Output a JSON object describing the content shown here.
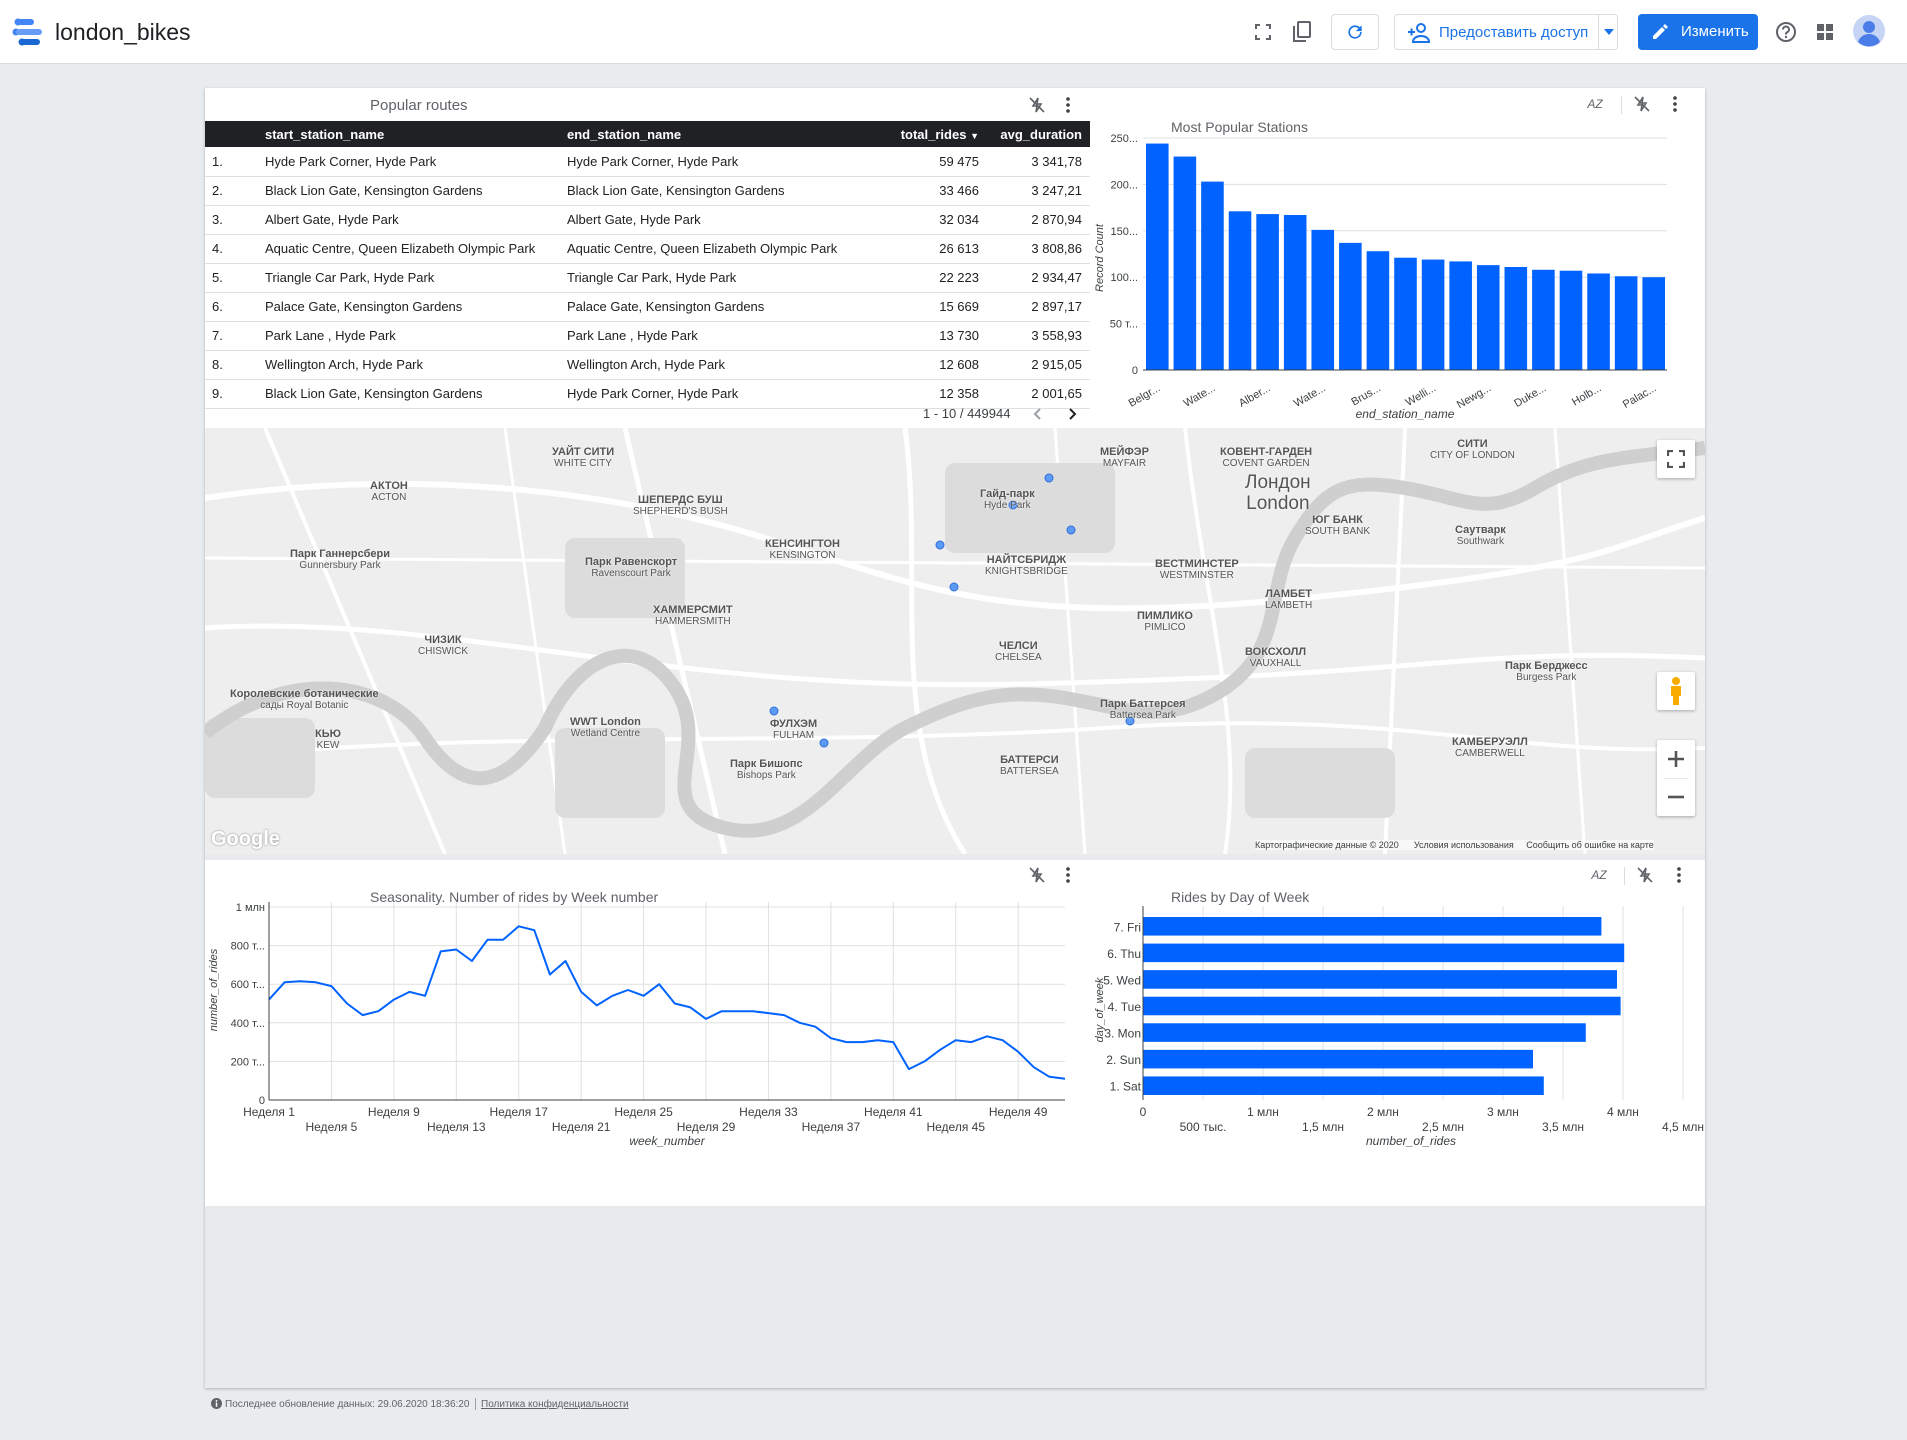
{
  "header": {
    "title": "london_bikes",
    "share_label": "Предоставить доступ",
    "edit_label": "Изменить"
  },
  "routes_table": {
    "title": "Popular routes",
    "columns": [
      "start_station_name",
      "end_station_name",
      "total_rides",
      "avg_duration"
    ],
    "rows": [
      [
        "1.",
        "Hyde Park Corner, Hyde Park",
        "Hyde Park Corner, Hyde Park",
        "59 475",
        "3 341,78"
      ],
      [
        "2.",
        "Black Lion Gate, Kensington Gardens",
        "Black Lion Gate, Kensington Gardens",
        "33 466",
        "3 247,21"
      ],
      [
        "3.",
        "Albert Gate, Hyde Park",
        "Albert Gate, Hyde Park",
        "32 034",
        "2 870,94"
      ],
      [
        "4.",
        "Aquatic Centre, Queen Elizabeth Olympic Park",
        "Aquatic Centre, Queen Elizabeth Olympic Park",
        "26 613",
        "3 808,86"
      ],
      [
        "5.",
        "Triangle Car Park, Hyde Park",
        "Triangle Car Park, Hyde Park",
        "22 223",
        "2 934,47"
      ],
      [
        "6.",
        "Palace Gate, Kensington Gardens",
        "Palace Gate, Kensington Gardens",
        "15 669",
        "2 897,17"
      ],
      [
        "7.",
        "Park Lane , Hyde Park",
        "Park Lane , Hyde Park",
        "13 730",
        "3 558,93"
      ],
      [
        "8.",
        "Wellington Arch, Hyde Park",
        "Wellington Arch, Hyde Park",
        "12 608",
        "2 915,05"
      ],
      [
        "9.",
        "Black Lion Gate, Kensington Gardens",
        "Hyde Park Corner, Hyde Park",
        "12 358",
        "2 001,65"
      ]
    ],
    "pagination": "1 - 10 / 449944",
    "sort_arrow": "▼"
  },
  "map": {
    "labels": [
      [
        "АКТОН",
        "ACTON"
      ],
      [
        "УАЙТ СИТИ",
        "WHITE CITY"
      ],
      [
        "ШЕПЕРДС БУШ",
        "SHEPHERD'S BUSH"
      ],
      [
        "КЕНСИНГТОН",
        "KENSINGTON"
      ],
      [
        "НАЙТСБРИДЖ",
        "KNIGHTSBRIDGE"
      ],
      [
        "Гайд-парк",
        "Hyde Park"
      ],
      [
        "МЕЙФЭР",
        "MAYFAIR"
      ],
      [
        "КОВЕНТ-ГАРДЕН",
        "COVENT GARDEN"
      ],
      [
        "СИТИ",
        "CITY OF LONDON"
      ],
      [
        "Лондон",
        "London"
      ],
      [
        "ЮГ БАНК",
        "SOUTH BANK"
      ],
      [
        "Саутварк",
        "Southwark"
      ],
      [
        "ВЕСТМИНСТЕР",
        "WESTMINSTER"
      ],
      [
        "ЛАМБЕТ",
        "LAMBETH"
      ],
      [
        "ПИМЛИКО",
        "PIMLICO"
      ],
      [
        "ВОКСХОЛЛ",
        "VAUXHALL"
      ],
      [
        "ЧЕЛСИ",
        "CHELSEA"
      ],
      [
        "ХАММЕРСМИТ",
        "HAMMERSMITH"
      ],
      [
        "ЧИЗИК",
        "CHISWICK"
      ],
      [
        "ФУЛХЭМ",
        "FULHAM"
      ],
      [
        "КЬЮ",
        "KEW"
      ],
      [
        "БАТТЕРСИ",
        "BATTERSEA"
      ],
      [
        "КАМБЕРУЭЛЛ",
        "CAMBERWELL"
      ],
      [
        "Парк Равенскорт",
        "Ravenscourt Park"
      ],
      [
        "Парк Ганнерсбери",
        "Gunnersbury Park"
      ],
      [
        "WWT London",
        "Wetland Centre"
      ],
      [
        "Парк Баттерсея",
        "Battersea Park"
      ],
      [
        "Парк Бишопс",
        "Bishops Park"
      ],
      [
        "Парк Берджесс",
        "Burgess Park"
      ],
      [
        "Королевские ботанические",
        "сады Royal Botanic"
      ]
    ],
    "google": "Google",
    "attribution": "Картографические данные © 2020",
    "terms": "Условия использования",
    "report": "Сообщить об ошибке на карте"
  },
  "stations_chart": {
    "title": "Most Popular Stations",
    "icon_sort": "AZ"
  },
  "weeks_chart": {
    "title": "Seasonality. Number of rides by Week number"
  },
  "days_chart": {
    "title": "Rides by Day of Week",
    "icon_sort": "AZ"
  },
  "chart_data": [
    {
      "type": "bar",
      "title": "Most Popular Stations",
      "xlabel": "end_station_name",
      "ylabel": "Record Count",
      "categories": [
        "Belgr...",
        "",
        "Wate...",
        "",
        "Alber...",
        "",
        "Wate...",
        "",
        "Brus...",
        "",
        "Welli...",
        "",
        "Newg...",
        "",
        "Duke...",
        "",
        "Holb...",
        "",
        "Palac..."
      ],
      "values": [
        244,
        230,
        203,
        171,
        168,
        167,
        151,
        137,
        128,
        121,
        119,
        117,
        113,
        111,
        108,
        107,
        104,
        101,
        100
      ],
      "ylim": [
        0,
        250
      ],
      "yticks": [
        "0",
        "50 т...",
        "100...",
        "150...",
        "200...",
        "250..."
      ],
      "color": "#0062ff"
    },
    {
      "type": "line",
      "title": "Seasonality. Number of rides by Week number",
      "xlabel": "week_number",
      "ylabel": "number_of_rides",
      "x": [
        1,
        2,
        3,
        4,
        5,
        6,
        7,
        8,
        9,
        10,
        11,
        12,
        13,
        14,
        15,
        16,
        17,
        18,
        19,
        20,
        21,
        22,
        23,
        24,
        25,
        26,
        27,
        28,
        29,
        30,
        31,
        32,
        33,
        34,
        35,
        36,
        37,
        38,
        39,
        40,
        41,
        42,
        43,
        44,
        45,
        46,
        47,
        48,
        49,
        50,
        51,
        52
      ],
      "values": [
        520,
        610,
        615,
        610,
        590,
        500,
        440,
        460,
        520,
        560,
        540,
        770,
        780,
        720,
        830,
        830,
        900,
        880,
        650,
        720,
        560,
        490,
        540,
        570,
        540,
        600,
        500,
        480,
        420,
        460,
        460,
        460,
        450,
        440,
        400,
        380,
        320,
        300,
        300,
        310,
        300,
        160,
        200,
        260,
        310,
        300,
        330,
        310,
        250,
        170,
        120,
        110
      ],
      "ylim": [
        0,
        1000000
      ],
      "yticks": [
        "0",
        "200 т...",
        "400 т...",
        "600 т...",
        "800 т...",
        "1 млн"
      ],
      "xticks_row1": [
        "Неделя 1",
        "Неделя 9",
        "Неделя 17",
        "Неделя 25",
        "Неделя 33",
        "Неделя 41",
        "Неделя 49"
      ],
      "xticks_row2": [
        "Неделя 5",
        "Неделя 13",
        "Неделя 21",
        "Неделя 29",
        "Неделя 37",
        "Неделя 45"
      ],
      "color": "#0062ff"
    },
    {
      "type": "bar",
      "orientation": "horizontal",
      "title": "Rides by Day of Week",
      "xlabel": "number_of_rides",
      "ylabel": "day_of_week",
      "categories": [
        "7. Fri",
        "6. Thu",
        "5. Wed",
        "4. Tue",
        "3. Mon",
        "2. Sun",
        "1. Sat"
      ],
      "values": [
        3820000,
        4010000,
        3950000,
        3980000,
        3690000,
        3250000,
        3340000
      ],
      "xlim": [
        0,
        4500000
      ],
      "xticks_row1": [
        "0",
        "1 млн",
        "2 млн",
        "3 млн",
        "4 млн"
      ],
      "xticks_row2": [
        "500 тыс.",
        "1,5 млн",
        "2,5 млн",
        "3,5 млн",
        "4,5 млн"
      ],
      "color": "#0062ff"
    }
  ],
  "footer": {
    "updated": "Последнее обновление данных: 29.06.2020 18:36:20",
    "privacy": "Политика конфиденциальности"
  }
}
